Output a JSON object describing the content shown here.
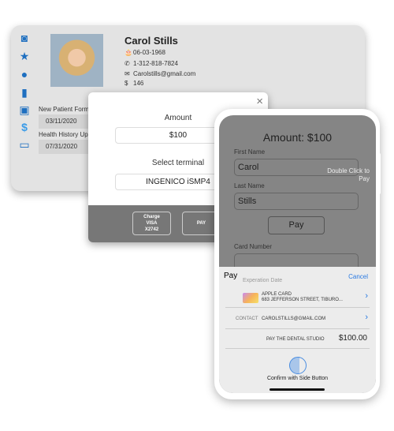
{
  "patient": {
    "name": "Carol Stills",
    "dob": "06-03-1968",
    "phone": "1-312-818-7824",
    "email": "Carolstills@gmail.com",
    "balance": "146"
  },
  "sidebar": [
    "camera-icon",
    "star-icon",
    "chat-icon",
    "document-icon",
    "image-icon",
    "dollar-icon",
    "credit-card-icon"
  ],
  "forms": [
    {
      "label": "New Patient Forms",
      "date": "03/11/2020"
    },
    {
      "label": "Health History Upd",
      "date": "07/31/2020"
    }
  ],
  "modal": {
    "amount_label": "Amount",
    "amount": "$100",
    "terminal_label": "Select terminal",
    "terminal": "INGENICO iSMP4",
    "charge_btn": [
      "Charge",
      "VISA",
      "X2742"
    ],
    "pay_btn": "PAY",
    "close": "×"
  },
  "phone": {
    "title": "Amount: $100",
    "first_name_label": "First Name",
    "first_name": "Carol",
    "last_name_label": "Last Name",
    "last_name": "Stills",
    "apple_pay_btn": "Pay",
    "card_number_label": "Card Number",
    "expiration_label": "Experation Date",
    "side_hint": "Double Click to Pay",
    "sheet": {
      "title": "Pay",
      "cancel": "Cancel",
      "card_name": "APPLE CARD",
      "card_address": "683 JEFFERSON STREET, TIBURO...",
      "contact_label": "CONTACT",
      "contact": "CAROLSTILLS@GMAIL.COM",
      "pay_to": "PAY THE DENTAL STUDIO",
      "total": "$100.00",
      "confirm": "Confirm with Side Button"
    }
  },
  "colors": {
    "accent": "#1e6fc0",
    "link": "#2a7ae2"
  }
}
